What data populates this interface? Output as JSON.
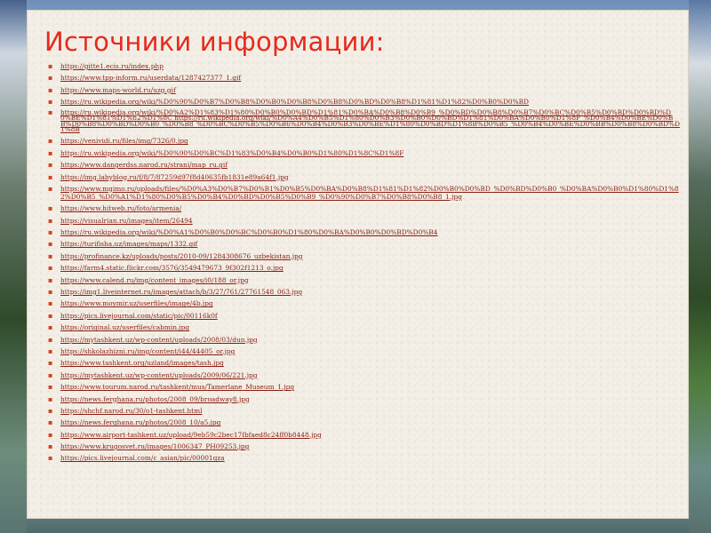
{
  "title": "Источники информации:",
  "bullet": "▪",
  "links": [
    "https://gitte1.ecis.ru/index.php",
    "https://www.tpp-inform.ru/userdata/1287427377_1.gif",
    "https://www.maps-world.ru/uzg.gif",
    "https://ru.wikipedia.org/wiki/%D0%90%D0%B7%D0%B8%D0%B0%D0%B8%D0%B8%D0%BD%D0%B8%D1%81%D1%82%D0%B0%D0%BD",
    "https://ru.wikipedia.org/wiki/%D0%A2%D1%83%D1%80%D0%B0%D0%BD%D1%81%D0%BA%D0%B8%D0%B9_%D0%BD%D0%B8%D0%B7%D0%BC%D0%B5%D0%BD%D0%BD%D0%BE%D1%81%D1%82%D1%8C https://ru.wikipedia.org/wiki/%D0%A4%D0%B5%D1%80%D0%B3%D0%B0%D0%BD%D1%81%D0%BA%D0%B0%D1%8F_%D0%B4%D0%BE%D0%BB%D0%B8%D0%BD%D0%B0_%D0%B8_%D0%BC%D0%B5%D0%B6%D0%B4%D0%B3%D0%BE%D1%80%D0%BD%D1%8B%D0%B5_%D0%B4%D0%BE%D0%BB%D0%B8%D0%BD%D1%8B",
    "https://venividi.ru/files/img/7326/0.jpg",
    "https://ru.wikipedia.org/wiki/%D0%90%D0%BC%D1%83%D0%B4%D0%B0%D1%80%D1%8C%D1%8F",
    "https://www.dangerdss.narod.ru/strani/map_ru.gif",
    "https://img.labyblog.ru/f/8/7/87259d97f8d40635fb1831e89a64f1.jpg",
    "https://www.mgimo.ru/uploads/files/%D0%A3%D0%B7%D0%B1%D0%B5%D0%BA%D0%B8%D1%81%D1%82%D0%B0%D0%BD_%D0%BD%D0%B0_%D0%BA%D0%B0%D1%80%D1%82%D0%B5_%D0%A1%D1%80%D0%B5%D0%B4%D0%BD%D0%B5%D0%B9_%D0%90%D0%B7%D0%B8%D0%B8_1.jpg",
    "https://www.hitweb.ru/foto/armenia/",
    "https://visualrian.ru/images/item/26494",
    "https://ru.wikipedia.org/wiki/%D0%A1%D0%B0%D0%BC%D0%B0%D1%80%D0%BA%D0%B0%D0%BD%D0%B4",
    "https://turifisha.uz/images/maps/1332.gif",
    "https://profinance.kz/uploads/posts/2010-09/1284308676_uzbekistan.jpg",
    "https://farm4.static.flickr.com/3576/3549479673_9f302f1213_o.jpg",
    "https://www.calend.ru/img/content_images/i0/188_or.jpg",
    "https://img1.liveinternet.ru/images/attach/b/3/27/761/27761548_063.jpg",
    "https://www.moymir.uz/userfiles/image/4b.jpg",
    "https://pics.livejournal.com/static/pic/00116k0f",
    "https://original.uz/userfiles/cabmin.jpg",
    "https://mytashkent.uz/wp-content/uploads/2008/03/dun.jpg",
    "https://shkolazhizni.ru/img/content/i44/44405_or.jpg",
    "https://www.tashkent.org/uzland/images/tash.jpg",
    "https://mytashkent.uz/wp-content/uploads/2009/06/221.jpg",
    "https://www.tourum.narod.ru/tashkent/mus/Tamerlane_Museum_1.jpg",
    "https://news.ferghana.ru/photos/2008_09/broadway8.jpg",
    "https://shchf.narod.ru/30/o1-tashkent.html",
    "https://news.ferghana.ru/photos/2008_10/a5.jpg",
    "https://www.airport-tashkent.uz/upload/9eb59c2bec17fbfaed8c24ff0b8448.jpg",
    "https://www.krugosvet.ru/images/1006347_PH09253.jpg",
    "https://pics.livejournal.com/c_asian/pic/00001qza"
  ]
}
